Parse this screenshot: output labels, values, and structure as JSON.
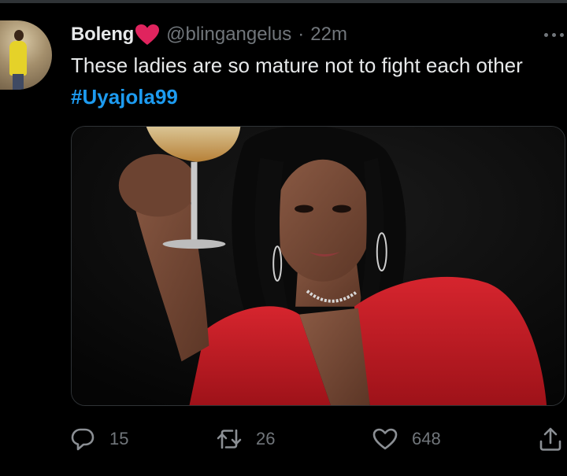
{
  "tweet": {
    "author_name": "Boleng",
    "handle": "@blingangelus",
    "separator": "·",
    "time": "22m",
    "text": "These ladies are so mature not to fight each other",
    "hashtag": "#Uyajola99"
  },
  "actions": {
    "replies": "15",
    "retweets": "26",
    "likes": "648"
  },
  "colors": {
    "background": "#000000",
    "text": "#e7e9ea",
    "muted": "#71767b",
    "link": "#1d9bf0",
    "heart": "#e0245e"
  },
  "icons": {
    "heart": "heart-icon",
    "more": "more-icon",
    "reply": "reply-icon",
    "retweet": "retweet-icon",
    "like": "like-icon",
    "share": "share-icon"
  }
}
